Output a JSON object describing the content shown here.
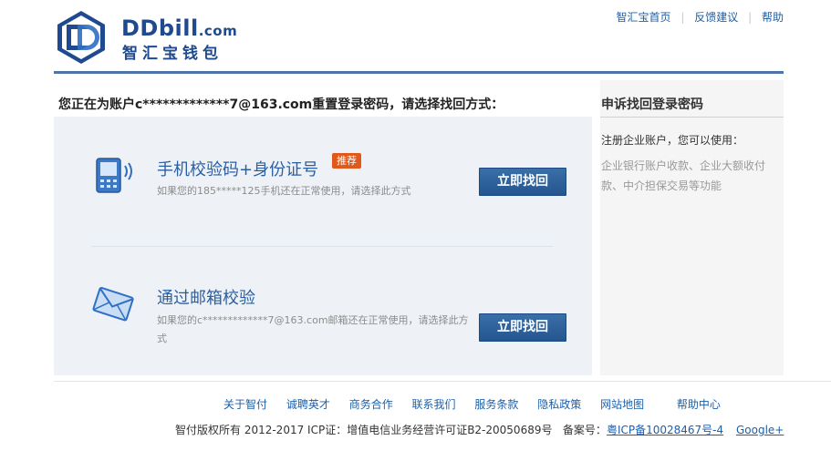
{
  "brand": {
    "name_en": "DDbill",
    "domain": ".com",
    "name_cn": "智汇宝钱包"
  },
  "topnav": {
    "home": "智汇宝首页",
    "feedback": "反馈建议",
    "help": "帮助"
  },
  "main": {
    "title": "您正在为账户c*************7@163.com重置登录密码，请选择找回方式：",
    "options": [
      {
        "title": "手机校验码+身份证号",
        "badge": "推荐",
        "desc": "如果您的185*****125手机还在正常使用，请选择此方式",
        "button": "立即找回",
        "icon": "mobile-phone-icon"
      },
      {
        "title": "通过邮箱校验",
        "desc": "如果您的c*************7@163.com邮箱还在正常使用，请选择此方式",
        "button": "立即找回",
        "icon": "envelope-icon"
      }
    ]
  },
  "sidebar": {
    "title": "申诉找回登录密码",
    "lead": "注册企业账户，您可以使用：",
    "desc": "企业银行账户收款、企业大额收付款、中介担保交易等功能"
  },
  "footer": {
    "links": [
      "关于智付",
      "诚聘英才",
      "商务合作",
      "联系我们",
      "服务条款",
      "隐私政策",
      "网站地图"
    ],
    "help": "帮助中心",
    "copyright": "智付版权所有 2012-2017 ICP证：增值电信业务经营许可证B2-20050689号",
    "record_label": "备案号：",
    "record_value": "粤ICP备10028467号-4",
    "google": "Google+"
  },
  "colors": {
    "brand": "#1f4a8f",
    "link": "#1d5fa8",
    "button": "#2a5d96",
    "badge": "#e0581a"
  }
}
